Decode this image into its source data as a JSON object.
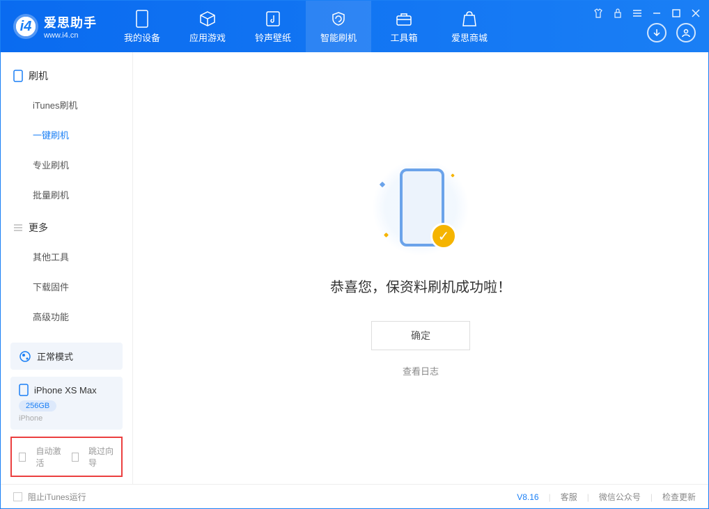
{
  "brand": {
    "title": "爱思助手",
    "subtitle": "www.i4.cn"
  },
  "tabs": [
    {
      "label": "我的设备"
    },
    {
      "label": "应用游戏"
    },
    {
      "label": "铃声壁纸"
    },
    {
      "label": "智能刷机"
    },
    {
      "label": "工具箱"
    },
    {
      "label": "爱思商城"
    }
  ],
  "sidebar": {
    "section1": {
      "title": "刷机",
      "items": [
        "iTunes刷机",
        "一键刷机",
        "专业刷机",
        "批量刷机"
      ]
    },
    "section2": {
      "title": "更多",
      "items": [
        "其他工具",
        "下载固件",
        "高级功能"
      ]
    }
  },
  "mode": {
    "label": "正常模式"
  },
  "device": {
    "name": "iPhone XS Max",
    "storage": "256GB",
    "type": "iPhone"
  },
  "checks": {
    "auto_activate": "自动激活",
    "skip_guide": "跳过向导"
  },
  "main": {
    "success": "恭喜您，保资料刷机成功啦！",
    "ok": "确定",
    "log": "查看日志"
  },
  "footer": {
    "block_itunes": "阻止iTunes运行",
    "version": "V8.16",
    "support": "客服",
    "wechat": "微信公众号",
    "update": "检查更新"
  }
}
